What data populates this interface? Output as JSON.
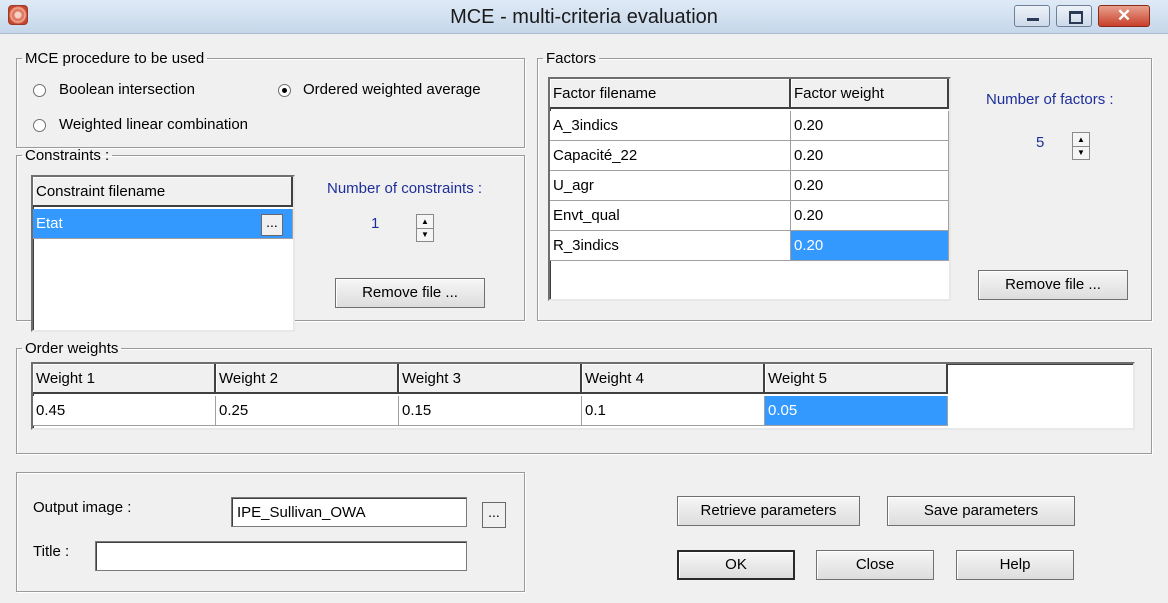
{
  "window": {
    "title": "MCE - multi-criteria evaluation",
    "minimize": "",
    "maximize": "",
    "close": "✕"
  },
  "procedure": {
    "legend": "MCE procedure to be used",
    "options": [
      {
        "label": "Boolean intersection",
        "selected": false
      },
      {
        "label": "Ordered weighted average",
        "selected": true
      },
      {
        "label": "Weighted linear combination",
        "selected": false
      }
    ]
  },
  "constraints": {
    "legend": "Constraints :",
    "header": "Constraint filename",
    "rows": [
      "Etat"
    ],
    "browse": "...",
    "count_label": "Number of constraints :",
    "count": "1",
    "remove_button": "Remove file ..."
  },
  "factors": {
    "legend": "Factors",
    "headers": [
      "Factor filename",
      "Factor weight"
    ],
    "rows": [
      {
        "name": "A_3indics",
        "weight": "0.20"
      },
      {
        "name": "Capacité_22",
        "weight": "0.20"
      },
      {
        "name": "U_agr",
        "weight": "0.20"
      },
      {
        "name": "Envt_qual",
        "weight": "0.20"
      },
      {
        "name": "R_3indics",
        "weight": "0.20"
      }
    ],
    "count_label": "Number of factors :",
    "count": "5",
    "remove_button": "Remove file ..."
  },
  "order_weights": {
    "legend": "Order weights",
    "headers": [
      "Weight 1",
      "Weight 2",
      "Weight 3",
      "Weight 4",
      "Weight 5"
    ],
    "values": [
      "0.45",
      "0.25",
      "0.15",
      "0.1",
      "0.05"
    ]
  },
  "output": {
    "image_label": "Output image :",
    "image_value": "IPE_Sullivan_OWA",
    "browse": "...",
    "title_label": "Title :",
    "title_value": ""
  },
  "buttons": {
    "retrieve": "Retrieve parameters",
    "save": "Save parameters",
    "ok": "OK",
    "close": "Close",
    "help": "Help"
  },
  "spinner": {
    "up": "▲",
    "down": "▼"
  }
}
